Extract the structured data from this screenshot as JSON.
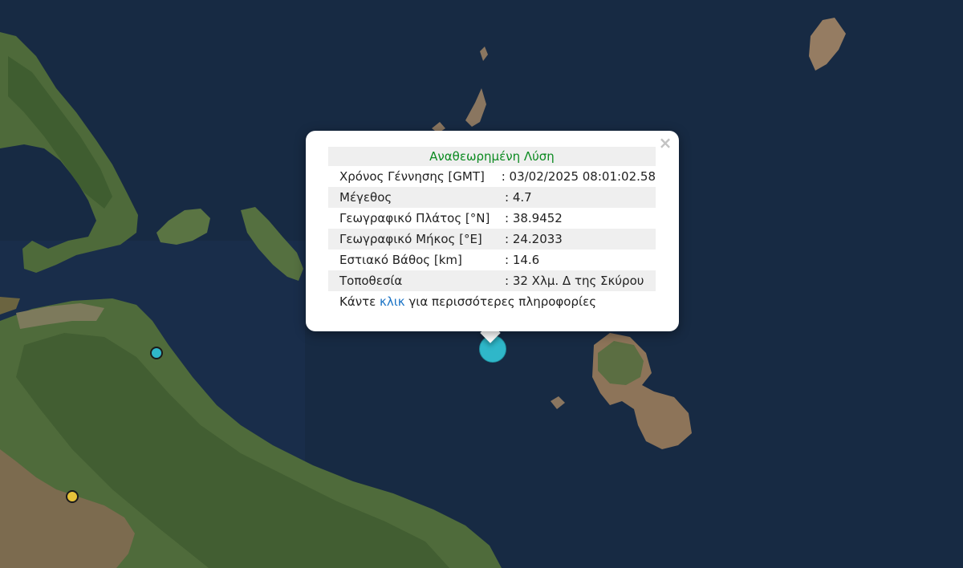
{
  "map": {
    "markers": [
      {
        "type": "selected-event",
        "color": "#2fb7c9"
      },
      {
        "type": "event",
        "color": "#2fb7c9"
      },
      {
        "type": "event",
        "color": "#e6c23a"
      }
    ]
  },
  "popup": {
    "close_label": "×",
    "title": "Αναθεωρημένη Λύση",
    "title_color": "#0b8a20",
    "rows": [
      {
        "label": "Χρόνος Γέννησης [GMT]",
        "value": ": 03/02/2025 08:01:02.58"
      },
      {
        "label": "Μέγεθος",
        "value": ": 4.7"
      },
      {
        "label": "Γεωγραφικό Πλάτος [°N]",
        "value": ": 38.9452"
      },
      {
        "label": "Γεωγραφικό Μήκος [°E]",
        "value": ": 24.2033"
      },
      {
        "label": "Εστιακό Βάθος [km]",
        "value": ": 14.6"
      },
      {
        "label": "Τοποθεσία",
        "value": ": 32 Χλμ. Δ της Σκύρου"
      }
    ],
    "more_prefix": "Κάντε ",
    "more_link": "κλικ",
    "more_suffix": " για περισσότερες πληροφορίες"
  }
}
